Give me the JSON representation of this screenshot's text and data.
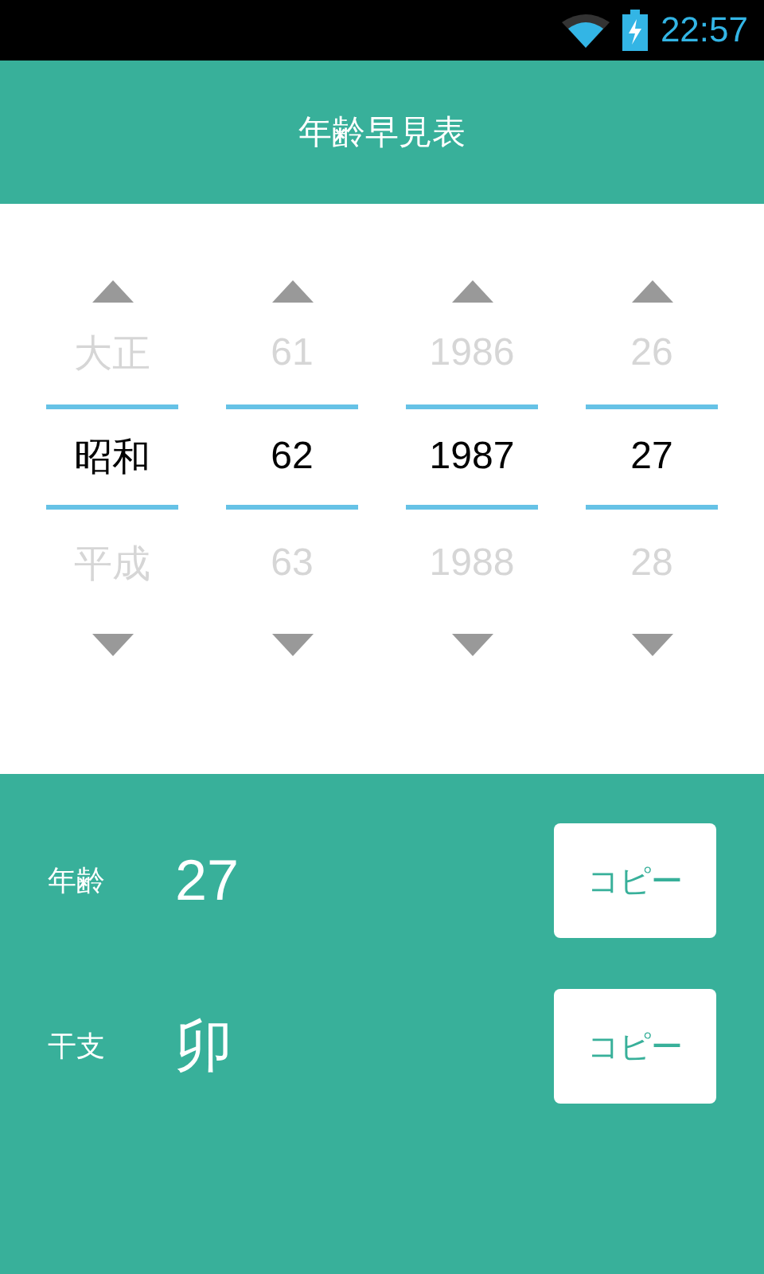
{
  "status_bar": {
    "time": "22:57"
  },
  "app_bar": {
    "title": "年齢早見表"
  },
  "picker": {
    "columns": [
      {
        "previous": "大正",
        "value": "昭和",
        "next": "平成"
      },
      {
        "previous": "61",
        "value": "62",
        "next": "63"
      },
      {
        "previous": "1986",
        "value": "1987",
        "next": "1988"
      },
      {
        "previous": "26",
        "value": "27",
        "next": "28"
      }
    ]
  },
  "results": [
    {
      "label": "年齢",
      "value": "27",
      "button": "コピー"
    },
    {
      "label": "干支",
      "value": "卯",
      "button": "コピー"
    }
  ]
}
